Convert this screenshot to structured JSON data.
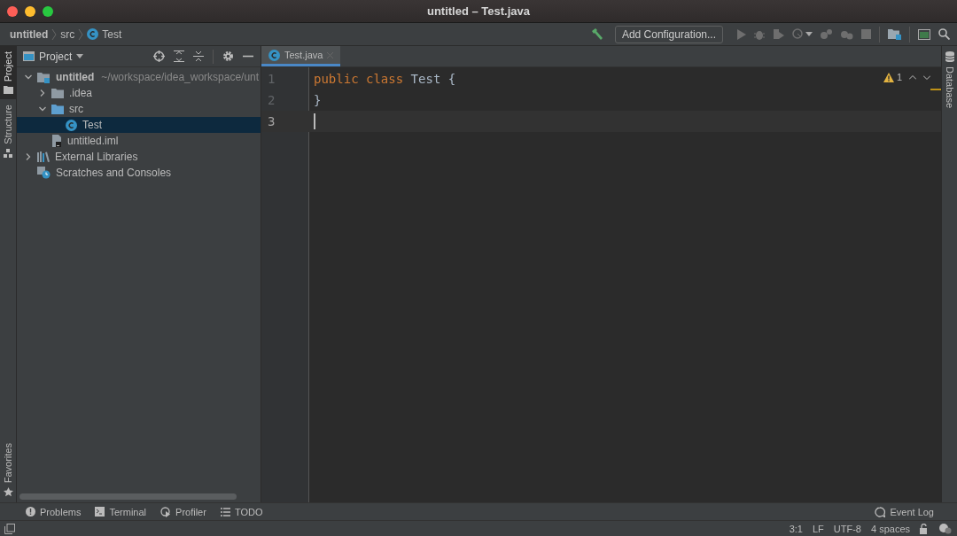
{
  "window": {
    "title": "untitled – Test.java"
  },
  "breadcrumbs": [
    {
      "label": "untitled",
      "kind": "project"
    },
    {
      "label": "src",
      "kind": "folder"
    },
    {
      "label": "Test",
      "kind": "class"
    }
  ],
  "toolbar": {
    "config_button": "Add Configuration..."
  },
  "left_stripe": [
    {
      "label": "Project",
      "selected": true
    },
    {
      "label": "Structure",
      "selected": false
    }
  ],
  "favorites_tab": {
    "label": "Favorites"
  },
  "project_panel": {
    "title": "Project",
    "tree": [
      {
        "label": "untitled",
        "path": "~/workspace/idea_workspace/unt",
        "kind": "module",
        "expanded": true,
        "selected": false,
        "children": [
          {
            "label": ".idea",
            "kind": "folder",
            "expanded": false,
            "selected": false
          },
          {
            "label": "src",
            "kind": "source",
            "expanded": true,
            "selected": false,
            "children": [
              {
                "label": "Test",
                "kind": "class",
                "selected": true
              }
            ]
          },
          {
            "label": "untitled.iml",
            "kind": "file",
            "selected": false
          }
        ]
      },
      {
        "label": "External Libraries",
        "kind": "libraries",
        "expanded": false,
        "selected": false
      },
      {
        "label": "Scratches and Consoles",
        "kind": "scratches",
        "selected": false
      }
    ]
  },
  "editor": {
    "tabs": [
      {
        "label": "Test.java",
        "selected": true
      }
    ],
    "warnings": "1",
    "lines": [
      {
        "number": "1",
        "current": false,
        "tokens": [
          {
            "text": "public",
            "kind": "keyword"
          },
          {
            "text": "class",
            "kind": "keyword"
          },
          {
            "text": "Test",
            "kind": "plain"
          },
          {
            "text": "{",
            "kind": "plain"
          }
        ]
      },
      {
        "number": "2",
        "current": false,
        "tokens": [
          {
            "text": "}",
            "kind": "plain"
          }
        ]
      },
      {
        "number": "3",
        "current": true
      }
    ]
  },
  "right_stripe": [
    {
      "label": "Database"
    }
  ],
  "bottom_tools": [
    {
      "label": "Problems",
      "kind": "problems"
    },
    {
      "label": "Terminal",
      "kind": "terminal"
    },
    {
      "label": "Profiler",
      "kind": "profiler"
    },
    {
      "label": "TODO",
      "kind": "todo"
    }
  ],
  "event_log": "Event Log",
  "status_bar": [
    "3:1",
    "LF",
    "UTF-8",
    "4 spaces"
  ]
}
